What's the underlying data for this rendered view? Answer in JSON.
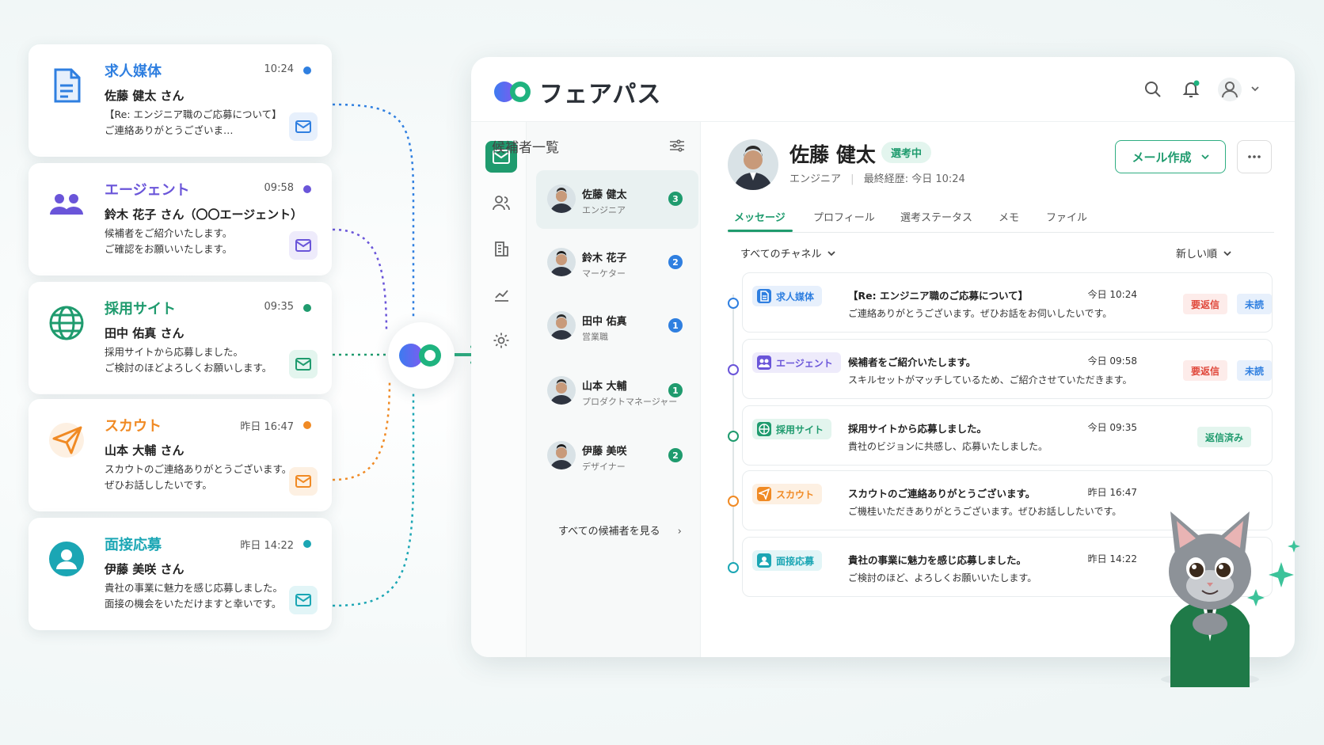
{
  "sources": [
    {
      "key": "media",
      "title": "求人媒体",
      "color": "#2f7fe0",
      "time": "10:24",
      "name": "佐藤 健太 さん",
      "line1": "【Re: エンジニア職のご応募について】",
      "line2": "ご連絡ありがとうございま…",
      "icon": "document-icon"
    },
    {
      "key": "agent",
      "title": "エージェント",
      "color": "#6a55d9",
      "time": "09:58",
      "name": "鈴木 花子 さん（〇〇エージェント）",
      "line1": "候補者をご紹介いたします。",
      "line2": "ご確認をお願いいたします。",
      "icon": "users-icon"
    },
    {
      "key": "site",
      "title": "採用サイト",
      "color": "#1f9b6e",
      "time": "09:35",
      "name": "田中 佑真 さん",
      "line1": "採用サイトから応募しました。",
      "line2": "ご検討のほどよろしくお願いします。",
      "icon": "globe-icon"
    },
    {
      "key": "scout",
      "title": "スカウト",
      "color": "#f08a24",
      "time": "昨日 16:47",
      "name": "山本 大輔 さん",
      "line1": "スカウトのご連絡ありがとうございます。",
      "line2": "ぜひお話ししたいです。",
      "icon": "paper-plane-icon"
    },
    {
      "key": "interview",
      "title": "面接応募",
      "color": "#1ba6b4",
      "time": "昨日 14:22",
      "name": "伊藤 美咲 さん",
      "line1": "貴社の事業に魅力を感じ応募しました。",
      "line2": "面接の機会をいただけますと幸いです。",
      "icon": "person-icon"
    }
  ],
  "app": {
    "brand": "フェアパス",
    "candidates_header": "候補者一覧",
    "candidates": [
      {
        "name": "佐藤 健太",
        "role": "エンジニア",
        "count": "3",
        "badge_color": "#1f9b6e"
      },
      {
        "name": "鈴木 花子",
        "role": "マーケター",
        "count": "2",
        "badge_color": "#2f7fe0"
      },
      {
        "name": "田中 佑真",
        "role": "営業職",
        "count": "1",
        "badge_color": "#2f7fe0"
      },
      {
        "name": "山本 大輔",
        "role": "プロダクトマネージャー",
        "count": "1",
        "badge_color": "#1f9b6e"
      },
      {
        "name": "伊藤 美咲",
        "role": "デザイナー",
        "count": "2",
        "badge_color": "#1f9b6e"
      }
    ],
    "see_all": "すべての候補者を見る",
    "profile": {
      "name": "佐藤 健太",
      "status": "選考中",
      "role": "エンジニア",
      "last_contact": "最終経歴: 今日 10:24",
      "compose": "メール作成"
    },
    "tabs": [
      "メッセージ",
      "プロフィール",
      "選考ステータス",
      "メモ",
      "ファイル"
    ],
    "filter_channel": "すべてのチャネル",
    "filter_sort": "新しい順",
    "messages": [
      {
        "channel": "求人媒体",
        "color": "#2f7fe0",
        "bg": "#e7f0fc",
        "title": "【Re: エンジニア職のご応募について】",
        "body": "ご連絡ありがとうございます。ぜひお話をお伺いしたいです。",
        "time": "今日 10:24",
        "tags": [
          "要返信",
          "未読"
        ]
      },
      {
        "channel": "エージェント",
        "color": "#6a55d9",
        "bg": "#eeebfb",
        "title": "候補者をご紹介いたします。",
        "body": "スキルセットがマッチしているため、ご紹介させていただきます。",
        "time": "今日 09:58",
        "tags": [
          "要返信",
          "未読"
        ]
      },
      {
        "channel": "採用サイト",
        "color": "#1f9b6e",
        "bg": "#e3f5ee",
        "title": "採用サイトから応募しました。",
        "body": "貴社のビジョンに共感し、応募いたしました。",
        "time": "今日 09:35",
        "tags": [
          "返信済み"
        ]
      },
      {
        "channel": "スカウト",
        "color": "#f08a24",
        "bg": "#fdf0e2",
        "title": "スカウトのご連絡ありがとうございます。",
        "body": "ご機桂いただきありがとうございます。ぜひお話ししたいです。",
        "time": "昨日 16:47",
        "tags": []
      },
      {
        "channel": "面接応募",
        "color": "#1ba6b4",
        "bg": "#e2f5f7",
        "title": "貴社の事業に魅力を感じ応募しました。",
        "body": "ご検討のほど、よろしくお願いいたします。",
        "time": "昨日 14:22",
        "tags": []
      }
    ],
    "tag_styles": {
      "要返信": {
        "fg": "#e0483b",
        "bg": "#fdecea"
      },
      "未読": {
        "fg": "#2f7fe0",
        "bg": "#e7f0fc"
      },
      "返信済み": {
        "fg": "#1f9b6e",
        "bg": "#e3f5ee"
      }
    }
  }
}
